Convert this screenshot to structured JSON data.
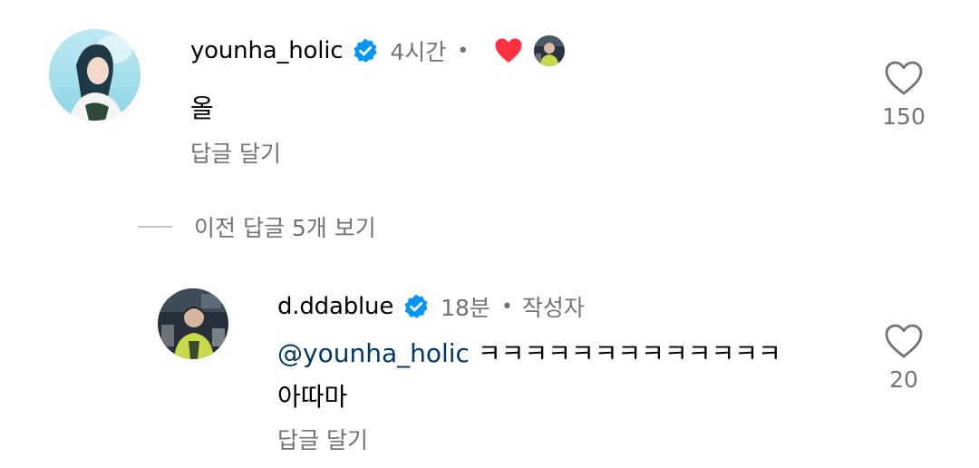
{
  "comments": [
    {
      "username": "younha_holic",
      "verified": true,
      "time": "4시간",
      "separator": "•",
      "liked_by_creator": true,
      "text": "올",
      "reply_label": "답글 달기",
      "like_count": "150",
      "like_icon": "heart-outline-icon"
    }
  ],
  "view_previous_replies": "이전 답글 5개 보기",
  "replies": [
    {
      "username": "d.ddablue",
      "verified": true,
      "time": "18분",
      "separator": "•",
      "author_badge": "작성자",
      "mention": "@younha_holic",
      "text_line1": "ㅋㅋㅋㅋㅋㅋㅋㅋㅋㅋㅋㅋㅋ",
      "text_line2": "아따마",
      "reply_label": "답글 달기",
      "like_count": "20",
      "like_icon": "heart-outline-icon"
    }
  ],
  "colors": {
    "verified_blue": "#0095f6",
    "liked_heart": "#ff3040",
    "secondary_text": "#737373",
    "mention": "#00376b"
  }
}
